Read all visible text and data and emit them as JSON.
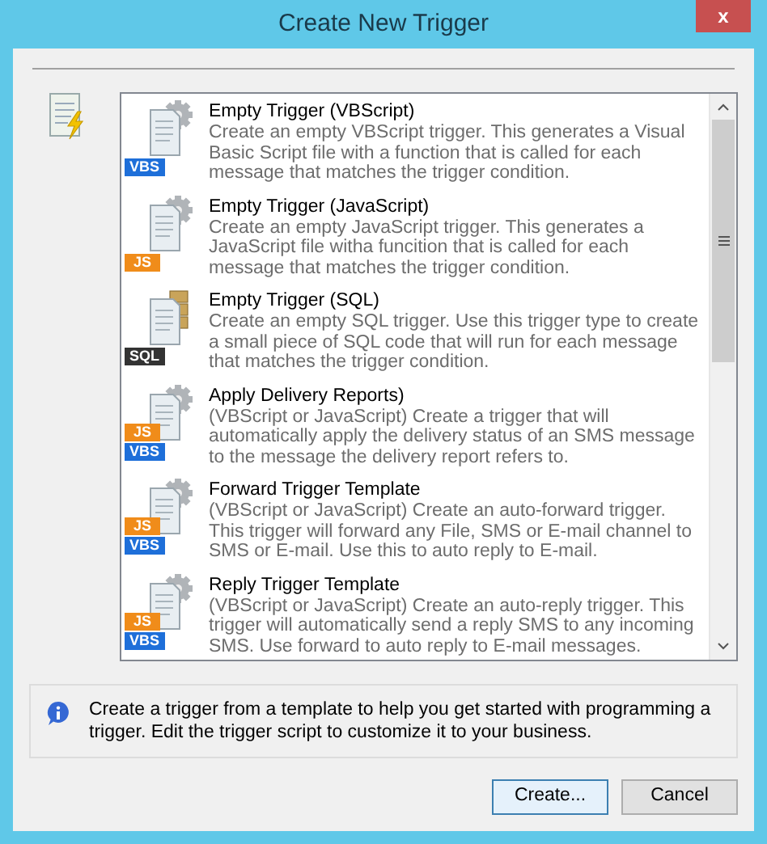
{
  "window": {
    "title": "Create New Trigger",
    "close": "x"
  },
  "templates": [
    {
      "title": "Empty Trigger (VBScript)",
      "description": "Create an empty VBScript trigger. This generates a Visual Basic Script file with a function that is called for each message that matches the trigger condition.",
      "kind": "gear",
      "badges": [
        {
          "text": "VBS",
          "kind": "vbs"
        }
      ]
    },
    {
      "title": "Empty Trigger (JavaScript)",
      "description": "Create an empty JavaScript trigger. This generates a JavaScript file witha funcition that is called for each message that matches the trigger condition.",
      "kind": "gear",
      "badges": [
        {
          "text": "JS",
          "kind": "js"
        }
      ]
    },
    {
      "title": "Empty Trigger (SQL)",
      "description": "Create an empty SQL trigger. Use this trigger type to create a small piece of SQL code that will run for each message that matches the trigger condition.",
      "kind": "database",
      "badges": [
        {
          "text": "SQL",
          "kind": "sql"
        }
      ]
    },
    {
      "title": "Apply Delivery Reports)",
      "description": "(VBScript or JavaScript) Create a trigger that will automatically apply the delivery status of an SMS message to the message the delivery report refers to.",
      "kind": "gear",
      "badges": [
        {
          "text": "JS",
          "kind": "js"
        },
        {
          "text": "VBS",
          "kind": "vbs"
        }
      ]
    },
    {
      "title": "Forward Trigger Template",
      "description": "(VBScript or JavaScript) Create an auto-forward trigger. This trigger will forward any File, SMS or E-mail channel to SMS or E-mail. Use this to auto reply to E-mail.",
      "kind": "gear",
      "badges": [
        {
          "text": "JS",
          "kind": "js"
        },
        {
          "text": "VBS",
          "kind": "vbs"
        }
      ]
    },
    {
      "title": "Reply Trigger Template",
      "description": "(VBScript or JavaScript) Create an auto-reply trigger. This trigger will automatically send a reply SMS to any incoming SMS. Use forward to auto reply to E-mail messages.",
      "kind": "gear",
      "badges": [
        {
          "text": "JS",
          "kind": "js"
        },
        {
          "text": "VBS",
          "kind": "vbs"
        }
      ]
    }
  ],
  "info": "Create a trigger from a template to help you get started with programming a trigger. Edit the trigger script to customize it to your business.",
  "buttons": [
    {
      "label": "Create...",
      "default": true
    },
    {
      "label": "Cancel",
      "default": false
    }
  ]
}
